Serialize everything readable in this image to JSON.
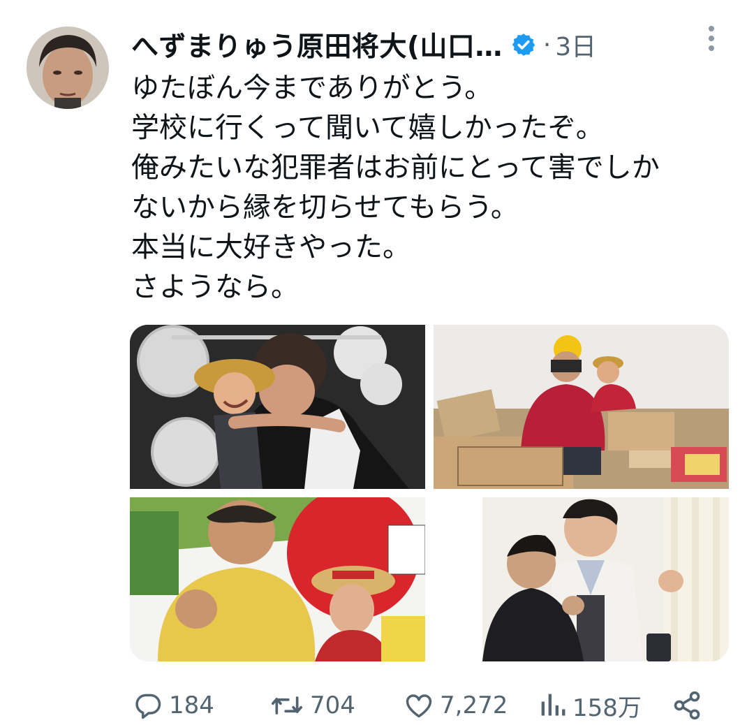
{
  "tweet": {
    "display_name": "へずまりゅう原田将大(山口…",
    "time_separator": "·",
    "time": "3日",
    "lines": [
      "ゆたぼん今までありがとう。",
      "学校に行くって聞いて嬉しかったぞ。",
      "俺みたいな犯罪者はお前にとって害でしか",
      "ないから縁を切らせてもらう。",
      "本当に大好きやった。",
      "さようなら。"
    ]
  },
  "icons": {
    "verified": "verified-badge-icon",
    "more": "more-vertical-icon",
    "reply": "reply-icon",
    "retweet": "retweet-icon",
    "like": "heart-icon",
    "views": "views-chart-icon",
    "share": "share-icon"
  },
  "colors": {
    "verified_blue": "#1d9bf0",
    "secondary_text": "#536471",
    "primary_text": "#0f1419"
  },
  "metrics": {
    "replies": "184",
    "retweets": "704",
    "likes": "7,272",
    "views": "158万"
  }
}
